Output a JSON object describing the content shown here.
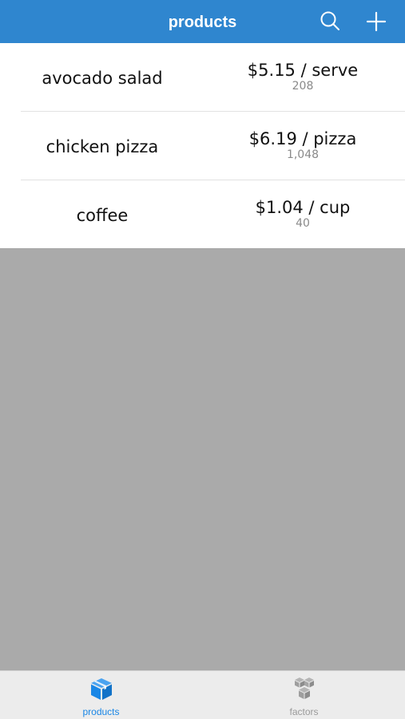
{
  "header": {
    "title": "products"
  },
  "icons": {
    "search": "search-icon",
    "add": "plus-icon",
    "products_tab": "box-icon",
    "factors_tab": "boxes-icon"
  },
  "colors": {
    "nav": "#2f86cf",
    "active_tab": "#1a87e6",
    "inactive_tab": "#9a9a9a",
    "background": "#aaaaaa"
  },
  "products": [
    {
      "name": "avocado salad",
      "price": "$5.15 / serve",
      "count": "208"
    },
    {
      "name": "chicken pizza",
      "price": "$6.19 / pizza",
      "count": "1,048"
    },
    {
      "name": "coffee",
      "price": "$1.04 / cup",
      "count": "40"
    }
  ],
  "tabs": [
    {
      "label": "products",
      "active": true
    },
    {
      "label": "factors",
      "active": false
    }
  ]
}
